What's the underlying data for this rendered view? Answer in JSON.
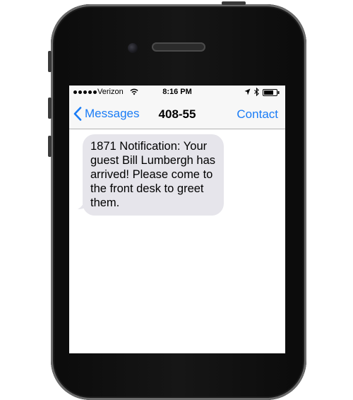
{
  "status_bar": {
    "carrier": "Verizon",
    "time": "8:16 PM"
  },
  "nav": {
    "back_label": "Messages",
    "title": "408-55",
    "contact_label": "Contact"
  },
  "messages": [
    {
      "direction": "incoming",
      "text": "1871 Notification: Your guest Bill Lumbergh has arrived! Please come to the front desk to greet them."
    }
  ],
  "colors": {
    "accent": "#1a7cf6",
    "incoming_bubble": "#e6e5eb",
    "bar_background": "#f7f7f7"
  },
  "icons": [
    "signal-dots-icon",
    "wifi-icon",
    "location-arrow-icon",
    "bluetooth-icon",
    "battery-icon",
    "chevron-left-icon"
  ]
}
